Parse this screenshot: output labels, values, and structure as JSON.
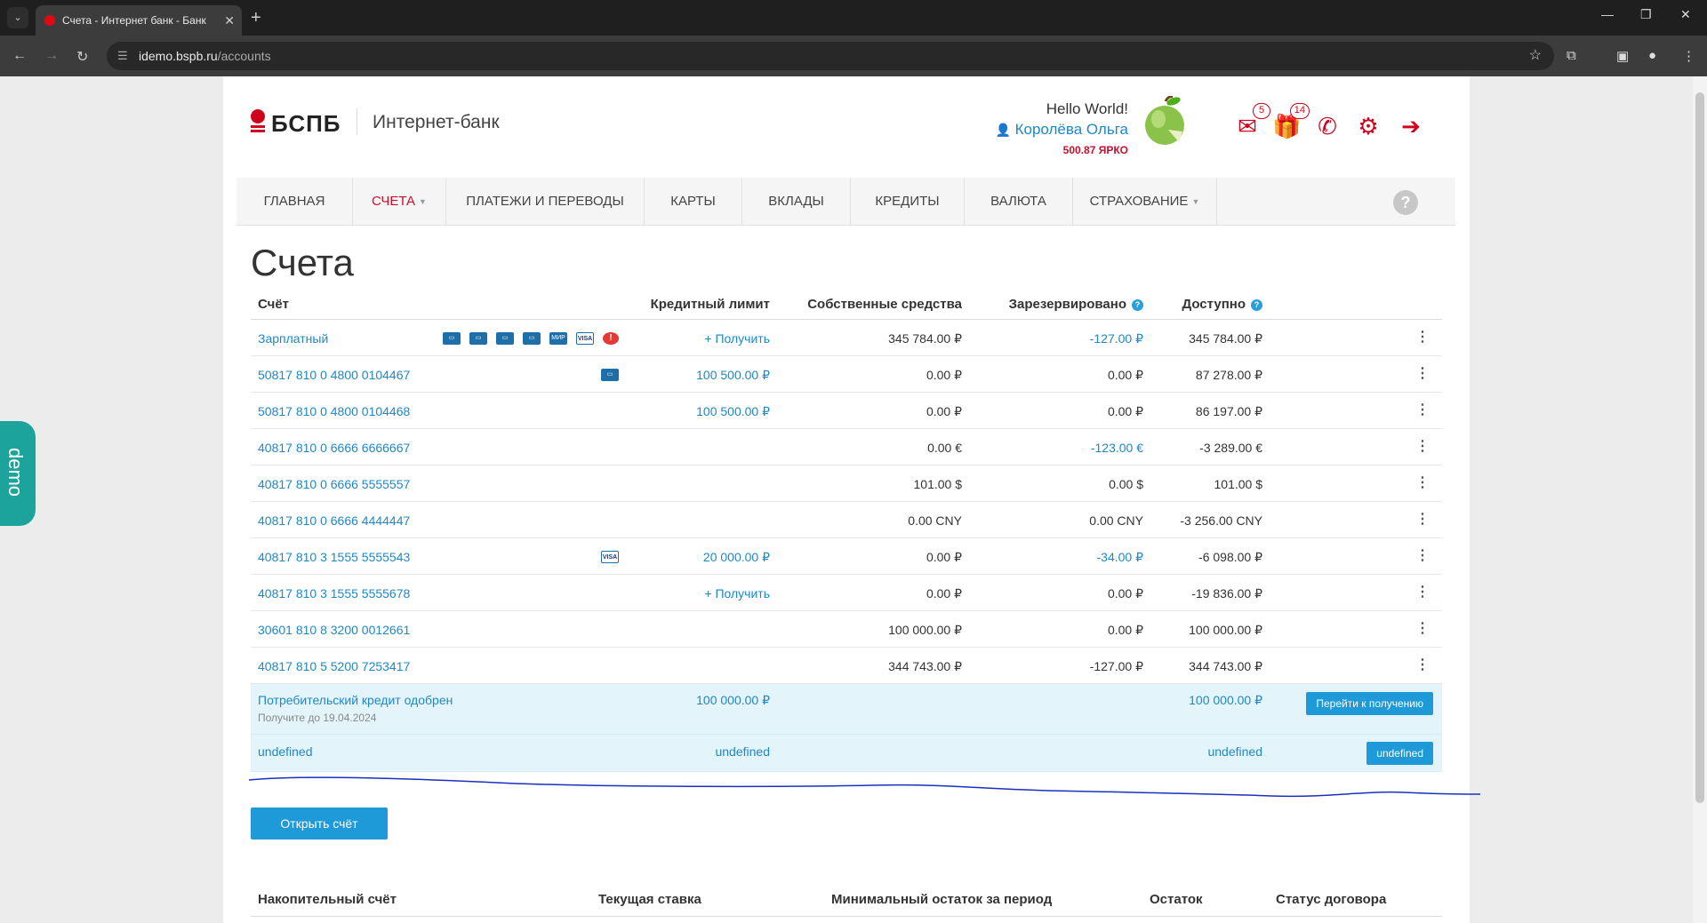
{
  "browser": {
    "tab_title": "Счета - Интернет банк - Банк",
    "url_host": "idemo.bspb.ru",
    "url_path": "/accounts"
  },
  "demo_label": "demo",
  "header": {
    "brand": "БСПБ",
    "bank_label": "Интернет-банк",
    "greeting": "Hello World!",
    "user_name": "Королёва Ольга",
    "points": "500.87 ЯРКО",
    "mail_badge": "5",
    "gift_badge": "14"
  },
  "nav": {
    "items": [
      "ГЛАВНАЯ",
      "СЧЕТА",
      "ПЛАТЕЖИ И ПЕРЕВОДЫ",
      "КАРТЫ",
      "ВКЛАДЫ",
      "КРЕДИТЫ",
      "ВАЛЮТА",
      "СТРАХОВАНИЕ"
    ],
    "active": "СЧЕТА",
    "help": "?"
  },
  "page_title": "Счета",
  "accounts": {
    "headers": {
      "account": "Счёт",
      "credit_limit": "Кредитный лимит",
      "own_funds": "Собственные средства",
      "reserved": "Зарезервировано",
      "available": "Доступно"
    },
    "rows": [
      {
        "name": "Зарплатный",
        "limit": "+ Получить",
        "own": "345 784.00 ₽",
        "reserved": "-127.00 ₽",
        "available": "345 784.00 ₽"
      },
      {
        "name": "50817 810 0 4800 0104467",
        "limit": "100 500.00 ₽",
        "own": "0.00 ₽",
        "reserved": "0.00 ₽",
        "available": "87 278.00 ₽"
      },
      {
        "name": "50817 810 0 4800 0104468",
        "limit": "100 500.00 ₽",
        "own": "0.00 ₽",
        "reserved": "0.00 ₽",
        "available": "86 197.00 ₽"
      },
      {
        "name": "40817 810 0 6666 6666667",
        "limit": "",
        "own": "0.00 €",
        "reserved": "-123.00 €",
        "available": "-3 289.00 €"
      },
      {
        "name": "40817 810 0 6666 5555557",
        "limit": "",
        "own": "101.00 $",
        "reserved": "0.00 $",
        "available": "101.00 $"
      },
      {
        "name": "40817 810 0 6666 4444447",
        "limit": "",
        "own": "0.00 CNY",
        "reserved": "0.00 CNY",
        "available": "-3 256.00 CNY"
      },
      {
        "name": "40817 810 3 1555 5555543",
        "limit": "20 000.00 ₽",
        "own": "0.00 ₽",
        "reserved": "-34.00 ₽",
        "available": "-6 098.00 ₽"
      },
      {
        "name": "40817 810 3 1555 5555678",
        "limit": "+ Получить",
        "own": "0.00 ₽",
        "reserved": "0.00 ₽",
        "available": "-19 836.00 ₽"
      },
      {
        "name": "30601 810 8 3200 0012661",
        "limit": "",
        "own": "100 000.00 ₽",
        "reserved": "0.00 ₽",
        "available": "100 000.00 ₽"
      },
      {
        "name": "40817 810 5 5200 7253417",
        "limit": "",
        "own": "344 743.00 ₽",
        "reserved": "-127.00 ₽",
        "available": "344 743.00 ₽"
      }
    ],
    "card_icon_labels": [
      "МИР",
      "VISA",
      "!"
    ],
    "offers": [
      {
        "title": "Потребительский кредит одобрен",
        "subtitle": "Получите до 19.04.2024",
        "limit": "100 000.00 ₽",
        "available": "100 000.00 ₽",
        "button": "Перейти к получению"
      },
      {
        "title": "undefined",
        "limit": "undefined",
        "available": "undefined",
        "button": "undefined"
      }
    ]
  },
  "open_account_button": "Открыть счёт",
  "savings": {
    "headers": {
      "account": "Накопительный счёт",
      "rate": "Текущая ставка",
      "min_balance": "Минимальный остаток за период",
      "balance": "Остаток",
      "status": "Статус договора"
    }
  },
  "colors": {
    "brand_red": "#d0021b",
    "link_blue": "#1e88c7",
    "button_blue": "#1e9ad8",
    "demo_teal": "#1ba39c"
  }
}
